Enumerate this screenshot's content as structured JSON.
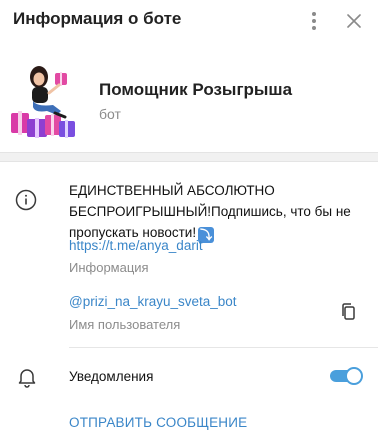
{
  "header": {
    "title": "Информация о боте",
    "more_icon": "more-vertical-icon",
    "close_icon": "close-icon"
  },
  "profile": {
    "name": "Помощник Розыгрыша",
    "status": "бот",
    "avatar_icon": "bot-avatar"
  },
  "info": {
    "description_line1": "ЕДИНСТВЕННЫЙ АБСОЛЮТНО",
    "description_line2": "БЕСПРОИГРЫШНЫЙ!Подпишись, что бы не",
    "description_line3": "пропускать новости!",
    "emoji": "⤵",
    "link": "https://t.me/anya_darit",
    "label": "Информация"
  },
  "username": {
    "value": "@prizi_na_krayu_sveta_bot",
    "label": "Имя пользователя"
  },
  "notifications": {
    "label": "Уведомления",
    "enabled": true
  },
  "actions": {
    "send_message": "ОТПРАВИТЬ СООБЩЕНИЕ"
  },
  "colors": {
    "accent": "#3a86c8",
    "toggle": "#4a9fdc",
    "muted": "#8c8c8c"
  }
}
